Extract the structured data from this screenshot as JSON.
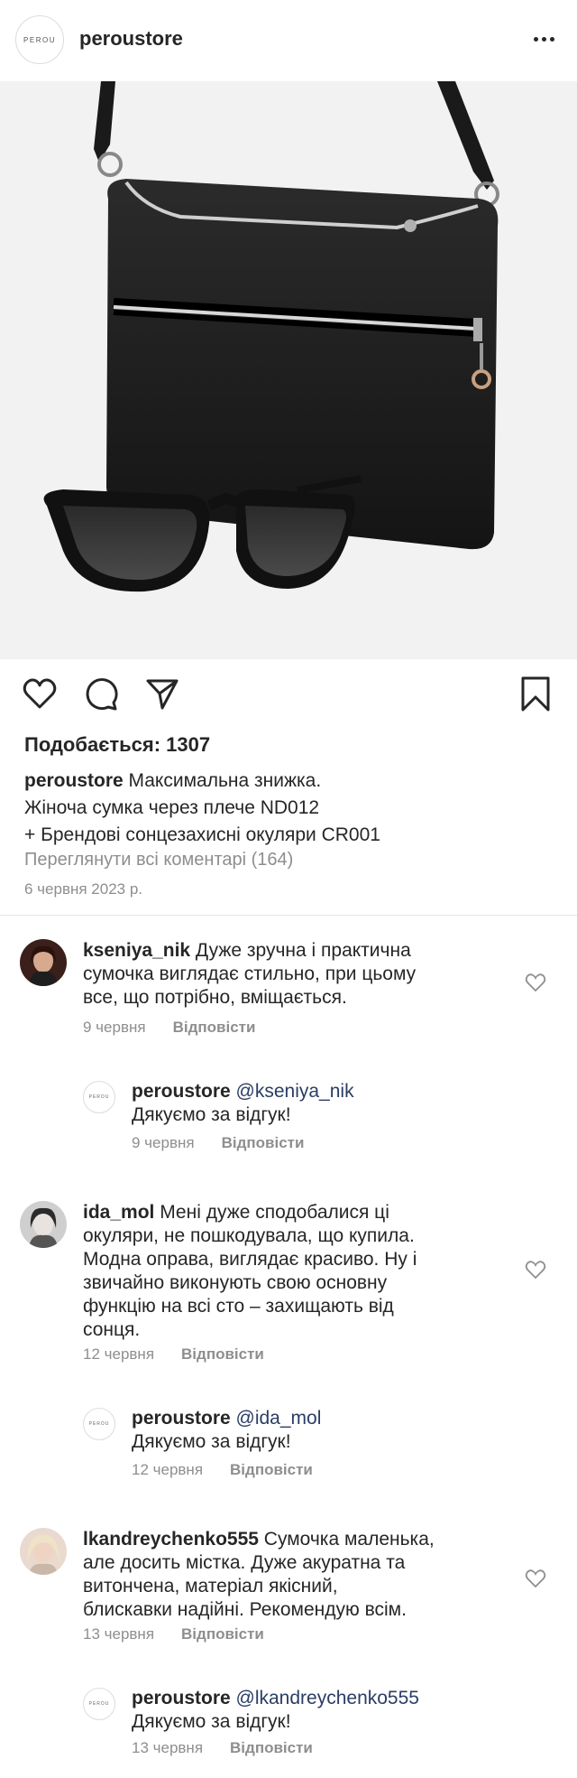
{
  "header": {
    "avatar_text": "PEROU",
    "username": "peroustore",
    "more_label": "more options"
  },
  "post": {
    "image_alt": "Black crossbody bag with sunglasses",
    "likes_label": "Подобається: 1307",
    "caption_user": "peroustore",
    "caption_lines": [
      " Максимальна знижка.",
      "Жіноча сумка через плече ND012",
      "+ Брендові сонцезахисні окуляри CR001"
    ],
    "view_all_comments": "Переглянути всі коментарі (164)",
    "date": "6 червня 2023 р.",
    "actions": [
      "heart-icon",
      "comment-icon",
      "share-icon",
      "bookmark-icon"
    ]
  },
  "comments": [
    {
      "user": "kseniya_nik",
      "text": " Дуже зручна і практична",
      "text2": "сумочка виглядає стильно, при цьому",
      "text3": "все, що потрібно, вміщається.",
      "date": "9 червня",
      "reply_label": "Відповісти",
      "reply": {
        "user": "peroustore",
        "mention": " @kseniya_nik",
        "text": "Дякуємо за відгук!",
        "date": "9 червня",
        "reply_label": "Відповісти"
      }
    },
    {
      "user": "ida_mol",
      "text": " Мені дуже сподобалися ці",
      "text2": "окуляри, не пошкодувала, що купила.",
      "text3": "Модна оправа, виглядає красиво. Ну і",
      "text4": "звичайно виконують свою основну",
      "text5": "функцію на всі сто – захищають від",
      "text6": "сонця.",
      "date": "12 червня",
      "reply_label": "Відповісти",
      "reply": {
        "user": "peroustore",
        "mention": " @ida_mol",
        "text": "Дякуємо за відгук!",
        "date": "12 червня",
        "reply_label": "Відповісти"
      }
    },
    {
      "user": "lkandreychenko555",
      "text": " Сумочка маленька,",
      "text2": "але досить містка. Дуже акуратна та",
      "text3": "витончена, матеріал якісний,",
      "text4": "блискавки надійні. Рекомендую всім.",
      "date": "13 червня",
      "reply_label": "Відповісти",
      "reply": {
        "user": "peroustore",
        "mention": " @lkandreychenko555",
        "text": "Дякуємо за відгук!",
        "date": "13 червня",
        "reply_label": "Відповісти"
      }
    }
  ]
}
